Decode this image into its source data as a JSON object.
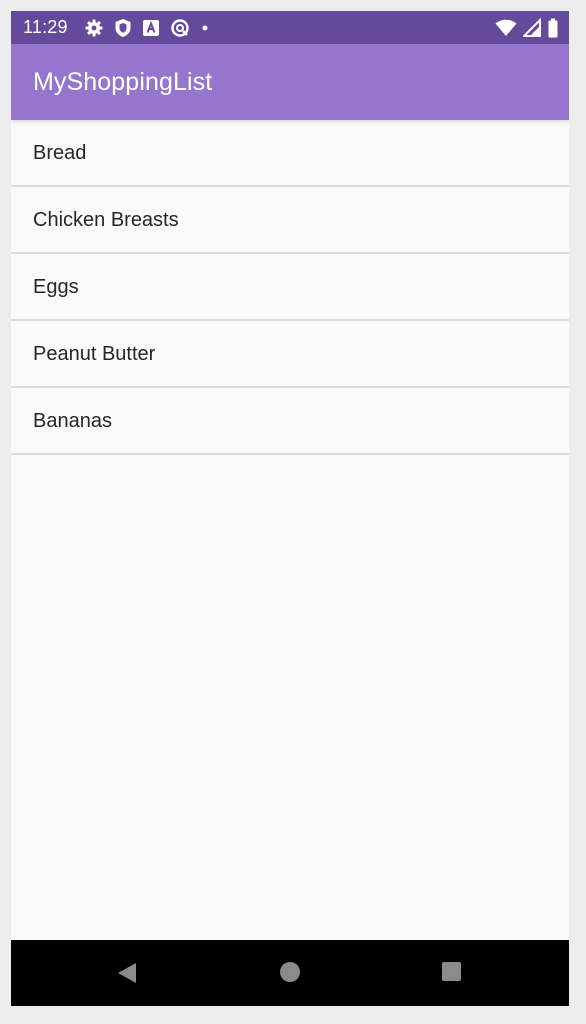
{
  "status_bar": {
    "time": "11:29",
    "background_color": "#654a9c",
    "left_icons": [
      "settings-gear-icon",
      "shield-icon",
      "keyboard-a-icon",
      "sync-icon",
      "dot-icon"
    ],
    "right_icons": [
      "wifi-icon",
      "cellular-signal-icon",
      "battery-icon"
    ]
  },
  "app_bar": {
    "title": "MyShoppingList",
    "background_color": "#9575cd"
  },
  "shopping_list": {
    "items": [
      {
        "label": "Bread"
      },
      {
        "label": "Chicken Breasts"
      },
      {
        "label": "Eggs"
      },
      {
        "label": "Peanut Butter"
      },
      {
        "label": "Bananas"
      }
    ]
  },
  "nav_bar": {
    "buttons": [
      "back-icon",
      "home-icon",
      "recents-icon"
    ]
  }
}
